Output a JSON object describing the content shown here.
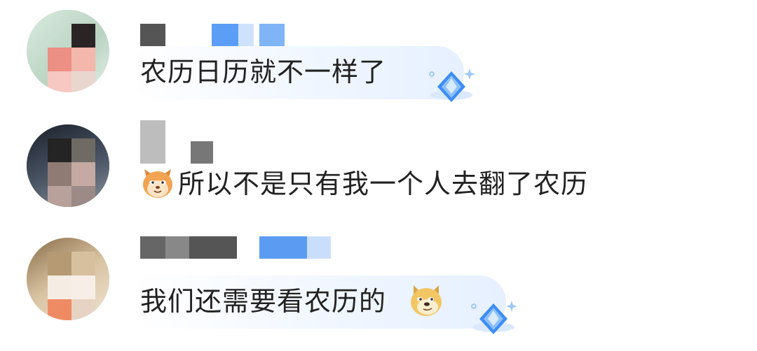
{
  "comments": [
    {
      "text": "农历日历就不一样了",
      "badge_icon": "diamond-badge-icon",
      "name_colors": [
        "#555555",
        "#5c9ef5",
        "#7fb4f7"
      ]
    },
    {
      "text": "所以不是只有我一个人去翻了农历",
      "lead_emoji": "cat-face-emoji",
      "name_colors": [
        "#777777",
        "#666666"
      ]
    },
    {
      "text": "我们还需要看农历的",
      "trail_emoji": "doge-face-emoji",
      "badge_icon": "diamond-badge-icon",
      "name_colors": [
        "#666666",
        "#888888",
        "#555555",
        "#5b9cf2",
        "#c9defa"
      ]
    }
  ],
  "colors": {
    "text": "#222222",
    "bubble_accent": "#e6f0ff",
    "badge_blue": "#3d8df5"
  }
}
